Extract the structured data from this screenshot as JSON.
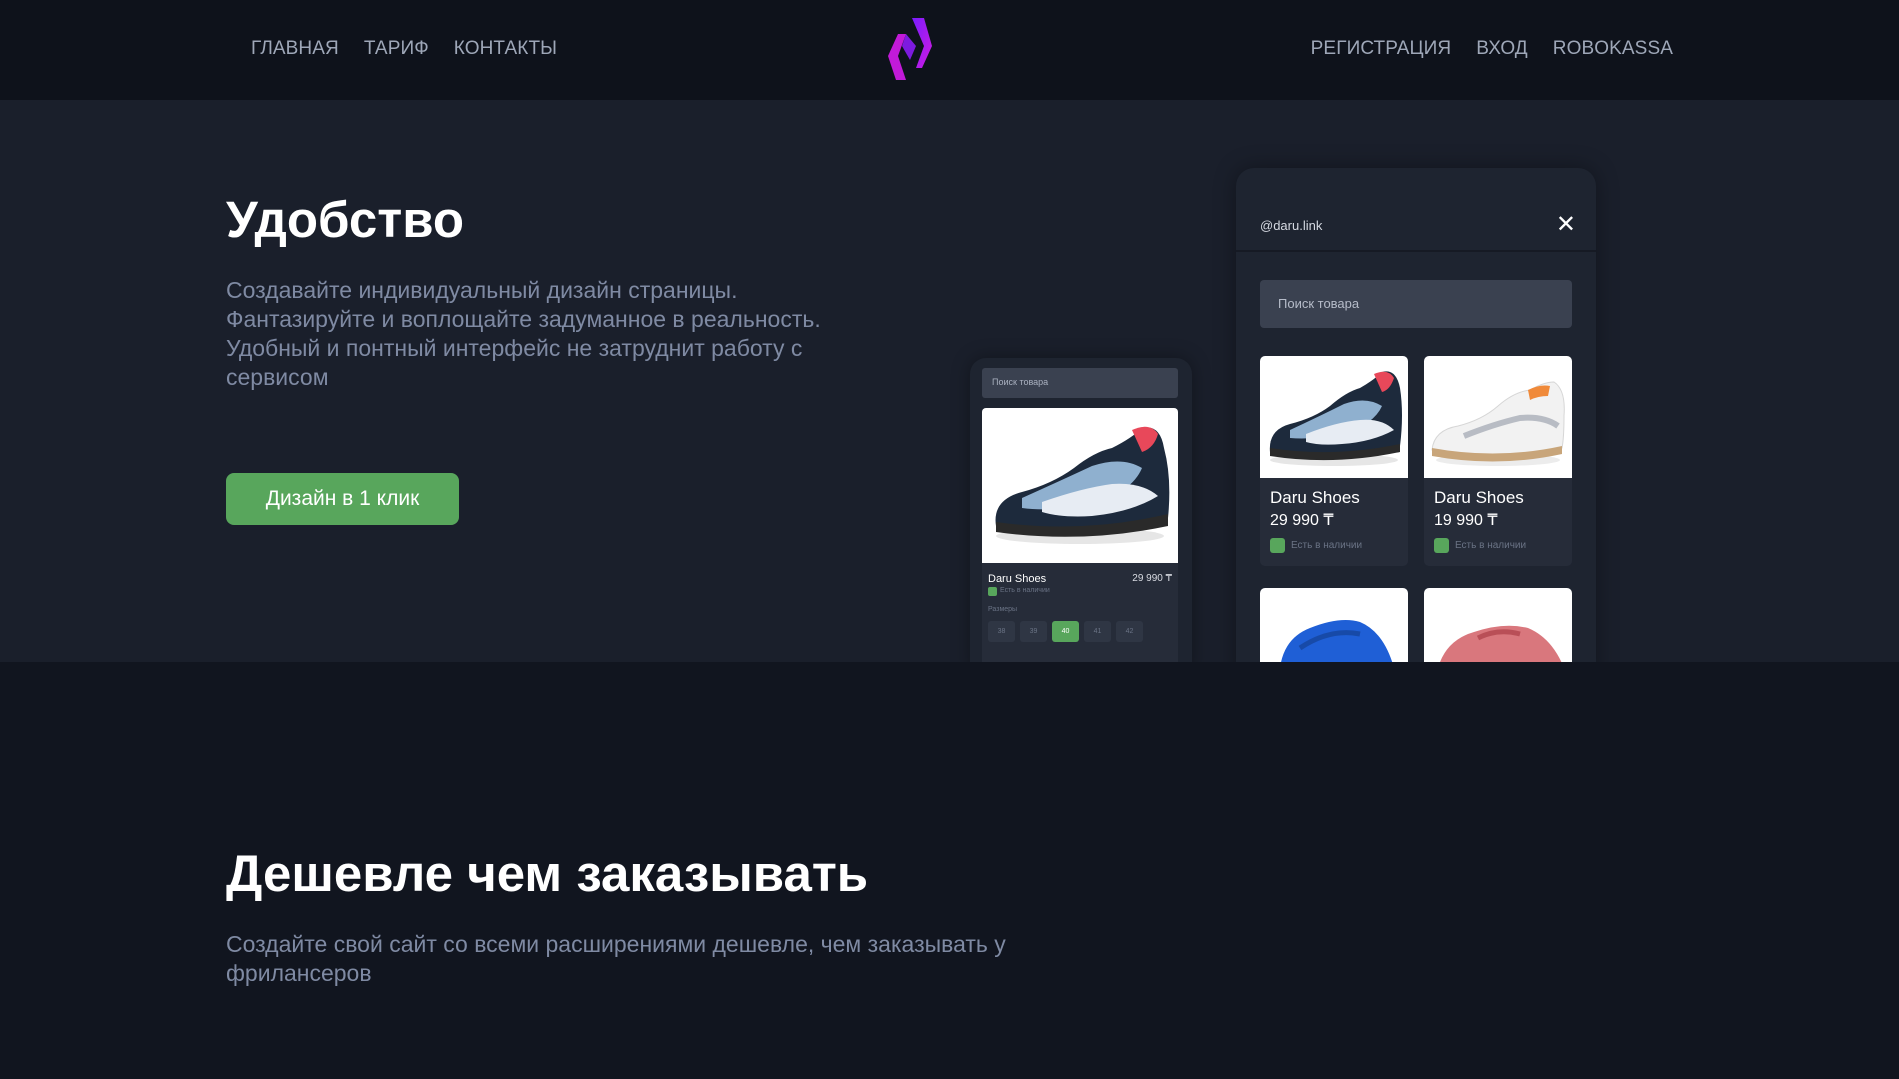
{
  "header": {
    "nav_left": [
      "ГЛАВНАЯ",
      "ТАРИФ",
      "КОНТАКТЫ"
    ],
    "nav_right": [
      "РЕГИСТРАЦИЯ",
      "ВХОД",
      "ROBOKASSA"
    ],
    "logo_icon": "brand-logo-icon"
  },
  "section1": {
    "title": "Удобство",
    "text_lines": [
      "Создавайте индивидуальный дизайн страницы.",
      "Фантазируйте и воплощайте задуманное в реальность.",
      "Удобный и понтный интерфейс не затруднит работу с",
      "сервисом"
    ],
    "cta_label": "Дизайн в 1 клик"
  },
  "mockup_small": {
    "search_placeholder": "Поиск товара",
    "product_name": "Daru Shoes",
    "product_price": "29 990 ₸",
    "stock": "Есть в наличии",
    "sizes_label": "Размеры",
    "sizes": [
      "38",
      "39",
      "40",
      "41",
      "42"
    ],
    "active_size": "40"
  },
  "mockup_big": {
    "handle": "@daru.link",
    "search_placeholder": "Поиск товара",
    "products": [
      {
        "name": "Daru Shoes",
        "price": "29 990 ₸",
        "stock": "Есть в наличии"
      },
      {
        "name": "Daru Shoes",
        "price": "19 990 ₸",
        "stock": "Есть в наличии"
      }
    ]
  },
  "section2": {
    "title": "Дешевле чем заказывать",
    "text_lines": [
      "Создайте свой сайт со всеми расширениями дешевле, чем заказывать у",
      "фрилансеров"
    ]
  },
  "colors": {
    "page_bg": "#11151f",
    "header_bg": "#0e121b",
    "section_bg": "#1a1f2b",
    "accent_green": "#58a65c",
    "muted_text": "#7f8aa3",
    "logo_purple": "#a020f0",
    "logo_magenta": "#e01ad0"
  }
}
